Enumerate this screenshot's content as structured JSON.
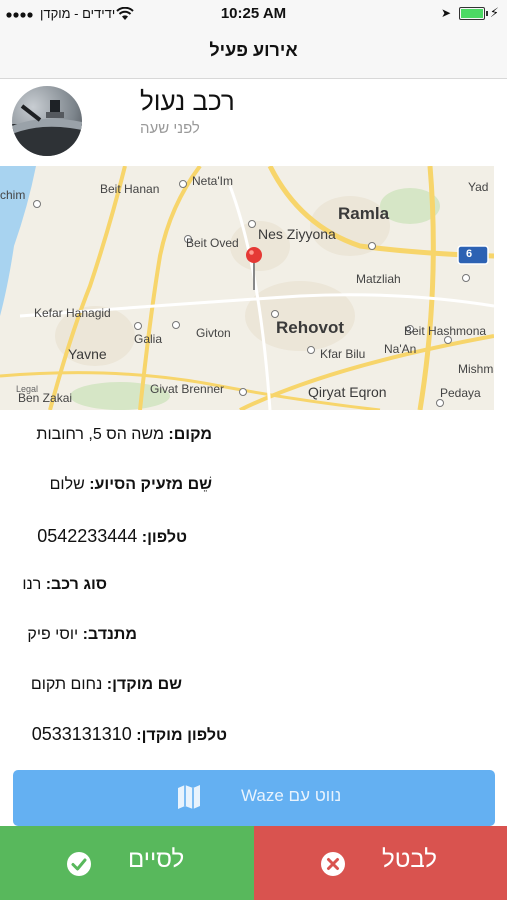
{
  "status_bar": {
    "carrier": "ידידים - מוקדן",
    "time": "10:25 AM",
    "battery_level": 1.0,
    "icons": [
      "signal-icon",
      "wifi-icon",
      "location-arrow-icon",
      "battery-icon",
      "charging-bolt-icon"
    ]
  },
  "nav": {
    "title": "אירוע פעיל"
  },
  "event": {
    "title": "רכב נעול",
    "time_ago": "לפני שעה"
  },
  "map": {
    "places": {
      "beit_hanan": "Beit Hanan",
      "neta_im": "Neta'Im",
      "ramla": "Ramla",
      "beit_oved": "Beit Oved",
      "nes_ziyyona": "Nes Ziyyona",
      "matzliah": "Matzliah",
      "kefar_hanagid": "Kefar Hanagid",
      "rehovot": "Rehovot",
      "beit_hashmona": "Beit Hashmona",
      "galia": "Galia",
      "givton": "Givton",
      "na_an": "Na'An",
      "yavne": "Yavne",
      "kfar_bilu": "Kfar Bilu",
      "mishma": "Mishma",
      "givat_brenner": "Givat Brenner",
      "qiryat_eqron": "Qiryat Eqron",
      "pedaya": "Pedaya",
      "ben_zakai": "Ben Zakai",
      "legal": "Legal",
      "chim": "chim",
      "yad": "Yad",
      "road_6": "6"
    }
  },
  "details": [
    {
      "label": "מקום:",
      "value": "משה הס 5, רחובות"
    },
    {
      "label": "שֵׁם מזעיק הסיוע:",
      "value": "שלום"
    },
    {
      "label": "טלפון:",
      "value": "0542233444"
    },
    {
      "label": "סוג רכב:",
      "value": "רנו"
    },
    {
      "label": "מתנדב:",
      "value": "יוסי פיק"
    },
    {
      "label": "שם מוקדן:",
      "value": "נחום תקום"
    },
    {
      "label": "טלפון מוקדן:",
      "value": "0533131310"
    }
  ],
  "waze_button": {
    "label": "נווט עם Waze",
    "icon": "map-icon"
  },
  "actions": {
    "finish_label": "לסיים",
    "finish_icon": "check-circle-icon",
    "cancel_label": "לבטל",
    "cancel_icon": "x-circle-icon"
  },
  "colors": {
    "finish": "#58b85c",
    "cancel": "#d9534f",
    "waze": "#64b0f2",
    "pin": "#e53935"
  }
}
